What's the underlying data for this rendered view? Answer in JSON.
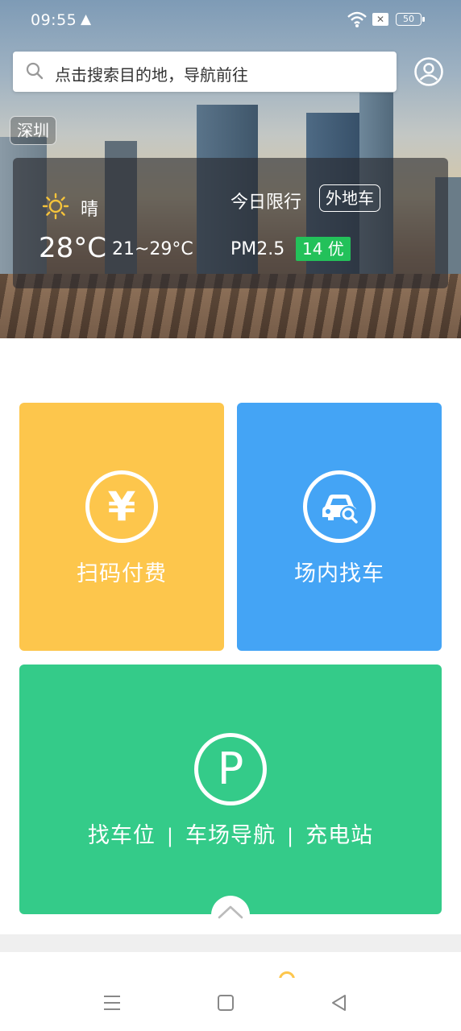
{
  "status_bar": {
    "time": "09:55",
    "warning_icon": "warning-triangle-icon",
    "battery": "50"
  },
  "search": {
    "placeholder": "点击搜索目的地，导航前往"
  },
  "city": "深圳",
  "weather": {
    "icon": "sunny-icon",
    "condition": "晴",
    "temperature": "28°C",
    "range": "21~29°C",
    "restriction_label": "今日限行",
    "restriction_value": "外地车",
    "pm_label": "PM2.5",
    "aqi": "14 优"
  },
  "tiles": {
    "pay": {
      "label": "扫码付费",
      "icon_glyph": "¥",
      "color": "#fdc64c"
    },
    "find_car": {
      "label": "场内找车",
      "color": "#44a4f5"
    },
    "parking": {
      "icon_glyph": "P",
      "color": "#34cb89",
      "links": [
        "找车位",
        "车场导航",
        "充电站"
      ],
      "separator": "|"
    }
  },
  "colors": {
    "aqi_good": "#23c15a"
  }
}
